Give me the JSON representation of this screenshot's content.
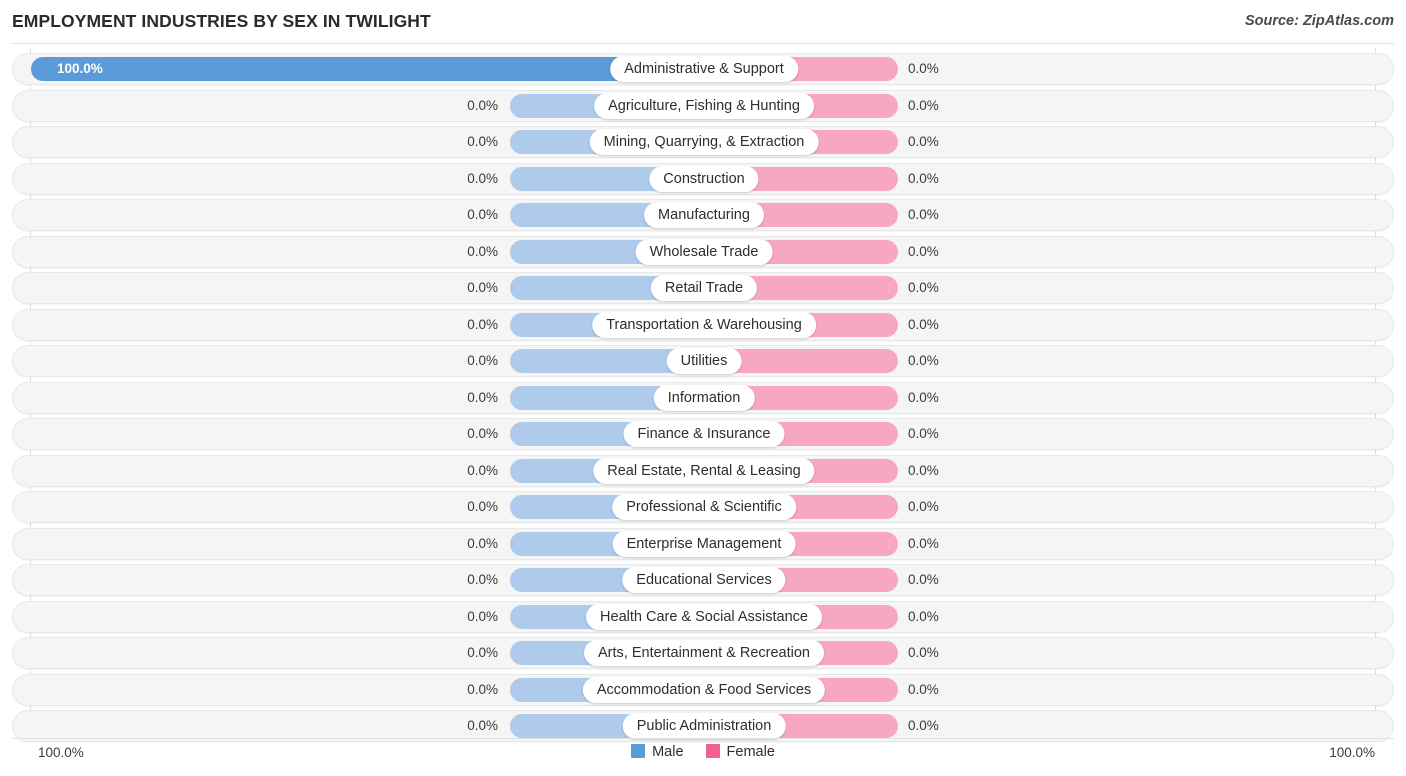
{
  "header": {
    "title": "EMPLOYMENT INDUSTRIES BY SEX IN TWILIGHT",
    "source": "Source: ZipAtlas.com"
  },
  "axis": {
    "left_tick": "100.0%",
    "right_tick": "100.0%"
  },
  "legend": {
    "items": [
      {
        "label": "Male",
        "color": "#5b9bd8"
      },
      {
        "label": "Female",
        "color": "#ef5f94"
      }
    ]
  },
  "colors": {
    "male_filled": "#5b9bd8",
    "male_empty": "#aecbec",
    "female_filled": "#ef5f94",
    "female_empty": "#f7a7c3",
    "row_track": "#f5f5f5",
    "row_border": "#e8e8e8"
  },
  "chart_data": {
    "type": "bar",
    "subtype": "diverging-horizontal",
    "title": "EMPLOYMENT INDUSTRIES BY SEX IN TWILIGHT",
    "xlabel": "",
    "ylabel": "",
    "xlim": [
      100.0,
      100.0
    ],
    "grid": false,
    "legend_position": "bottom-center",
    "axis_ticks": [
      "100.0%",
      "100.0%"
    ],
    "categories": [
      "Administrative & Support",
      "Agriculture, Fishing & Hunting",
      "Mining, Quarrying, & Extraction",
      "Construction",
      "Manufacturing",
      "Wholesale Trade",
      "Retail Trade",
      "Transportation & Warehousing",
      "Utilities",
      "Information",
      "Finance & Insurance",
      "Real Estate, Rental & Leasing",
      "Professional & Scientific",
      "Enterprise Management",
      "Educational Services",
      "Health Care & Social Assistance",
      "Arts, Entertainment & Recreation",
      "Accommodation & Food Services",
      "Public Administration"
    ],
    "series": [
      {
        "name": "Male",
        "color": "#5b9bd8",
        "values": [
          100.0,
          0.0,
          0.0,
          0.0,
          0.0,
          0.0,
          0.0,
          0.0,
          0.0,
          0.0,
          0.0,
          0.0,
          0.0,
          0.0,
          0.0,
          0.0,
          0.0,
          0.0,
          0.0
        ],
        "labels": [
          "100.0%",
          "0.0%",
          "0.0%",
          "0.0%",
          "0.0%",
          "0.0%",
          "0.0%",
          "0.0%",
          "0.0%",
          "0.0%",
          "0.0%",
          "0.0%",
          "0.0%",
          "0.0%",
          "0.0%",
          "0.0%",
          "0.0%",
          "0.0%",
          "0.0%"
        ]
      },
      {
        "name": "Female",
        "color": "#ef5f94",
        "values": [
          0.0,
          0.0,
          0.0,
          0.0,
          0.0,
          0.0,
          0.0,
          0.0,
          0.0,
          0.0,
          0.0,
          0.0,
          0.0,
          0.0,
          0.0,
          0.0,
          0.0,
          0.0,
          0.0
        ],
        "labels": [
          "0.0%",
          "0.0%",
          "0.0%",
          "0.0%",
          "0.0%",
          "0.0%",
          "0.0%",
          "0.0%",
          "0.0%",
          "0.0%",
          "0.0%",
          "0.0%",
          "0.0%",
          "0.0%",
          "0.0%",
          "0.0%",
          "0.0%",
          "0.0%",
          "0.0%"
        ]
      }
    ]
  }
}
